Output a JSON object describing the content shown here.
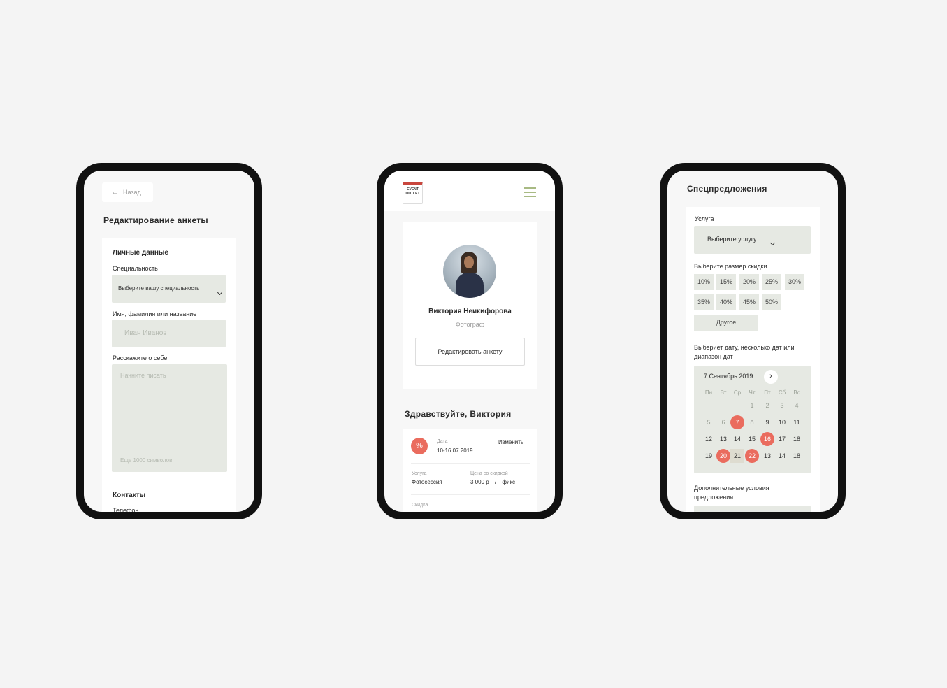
{
  "edit": {
    "back": "Назад",
    "title": "Редактирование анкеты",
    "personal": "Личные данные",
    "specialty_label": "Специальность",
    "specialty_select": "Выберите вашу специальность",
    "name_label": "Имя, фамилия или название",
    "name_placeholder": "Иван Иванов",
    "about_label": "Расскажите о себе",
    "about_placeholder": "Начните писать",
    "about_hint": "Еще 1000 символов",
    "contacts": "Контакты",
    "phone_label": "Телефон"
  },
  "profile": {
    "logo_line1": "EVENT",
    "logo_line2": "OUTLET",
    "name": "Виктория Неикифорова",
    "role": "Фотограф",
    "edit_button": "Редактировать анкету",
    "greeting": "Здравствуйте, Виктория",
    "offer": {
      "date_label": "Дата",
      "date_value": "10-16.07.2019",
      "change": "Изменить",
      "service_label": "Услуга",
      "service_value": "Фотосессия",
      "price_label": "Цена со скидкой",
      "price_value": "3 000 р",
      "price_sep": "/",
      "price_type": "фикс",
      "discount_label": "Скидка"
    }
  },
  "specials": {
    "title": "Спецпредложения",
    "service_label": "Услуга",
    "service_select": "Выберите услугу",
    "discount_label": "Выберите размер скидки",
    "discounts": [
      "10%",
      "15%",
      "20%",
      "25%",
      "30%",
      "35%",
      "40%",
      "45%",
      "50%"
    ],
    "other": "Другое",
    "date_label_1": "Выбериет дату, несколько дат или",
    "date_label_2": "диапазон дат",
    "calendar": {
      "month": "7 Сентябрь 2019",
      "weekdays": [
        "Пн",
        "Вт",
        "Ср",
        "Чт",
        "Пт",
        "Сб",
        "Вс"
      ],
      "rows": [
        [
          "",
          "",
          "",
          "1",
          "2",
          "3",
          "4"
        ],
        [
          "5",
          "6",
          "7",
          "8",
          "9",
          "10",
          "11"
        ],
        [
          "12",
          "13",
          "14",
          "15",
          "16",
          "17",
          "18"
        ],
        [
          "19",
          "20",
          "21",
          "22",
          "13",
          "14",
          "18"
        ]
      ]
    },
    "extra_1": "Дополнительные условия",
    "extra_2": "предложения"
  },
  "colors": {
    "accent": "#ea6c5e",
    "field": "#e6e9e3",
    "burger": "#a8ba83",
    "frame": "#111111"
  }
}
